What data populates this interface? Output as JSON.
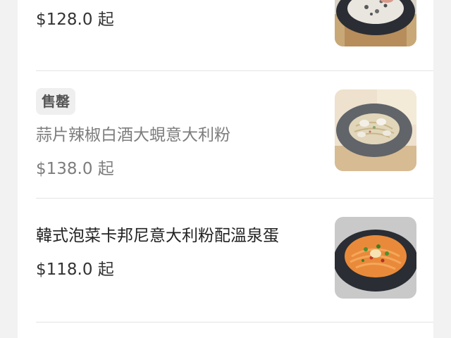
{
  "menu": {
    "items": [
      {
        "name": "",
        "price": "$128.0 起",
        "sold_out": false,
        "image": "seafood-risotto-dish"
      },
      {
        "badge": "售罄",
        "name": "蒜片辣椒白酒大蜆意大利粉",
        "price": "$138.0 起",
        "sold_out": true,
        "image": "clam-spaghetti-dish"
      },
      {
        "name": "韓式泡菜卡邦尼意大利粉配溫泉蛋",
        "price": "$118.0 起",
        "sold_out": false,
        "image": "kimchi-carbonara-dish"
      }
    ]
  },
  "colors": {
    "background": "#f2f2f2",
    "card": "#ffffff",
    "text": "#222222",
    "muted": "#7d7d7d",
    "badge_bg": "#efefef"
  }
}
